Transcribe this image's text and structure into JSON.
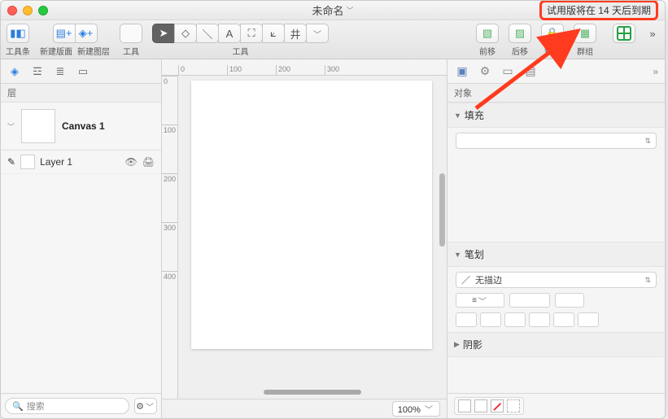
{
  "titlebar": {
    "title": "未命名",
    "trial": "试用版将在 14 天后到期"
  },
  "toolbar": {
    "toolstrip_label": "工具条",
    "newpage_label": "新建版面",
    "newlayer_label": "新建图层",
    "tools_label_a": "工具",
    "tools_label_b": "工具",
    "front_label": "前移",
    "back_label": "后移",
    "lock_label": "锁定",
    "group_label": "群组"
  },
  "left": {
    "section": "层",
    "canvas_name": "Canvas 1",
    "layer_name": "Layer 1",
    "pencil_glyph": "✎",
    "eye_glyph": "👁",
    "print_glyph": "🖨",
    "search_placeholder": "搜索"
  },
  "center": {
    "ruler_h": [
      "0",
      "100",
      "200",
      "300"
    ],
    "ruler_v": [
      "0",
      "100",
      "200",
      "300",
      "400"
    ],
    "zoom": "100%"
  },
  "right": {
    "object_label": "对象",
    "fill_label": "填充",
    "stroke_label": "笔划",
    "stroke_none": "无描边",
    "shadow_label": "阴影"
  }
}
